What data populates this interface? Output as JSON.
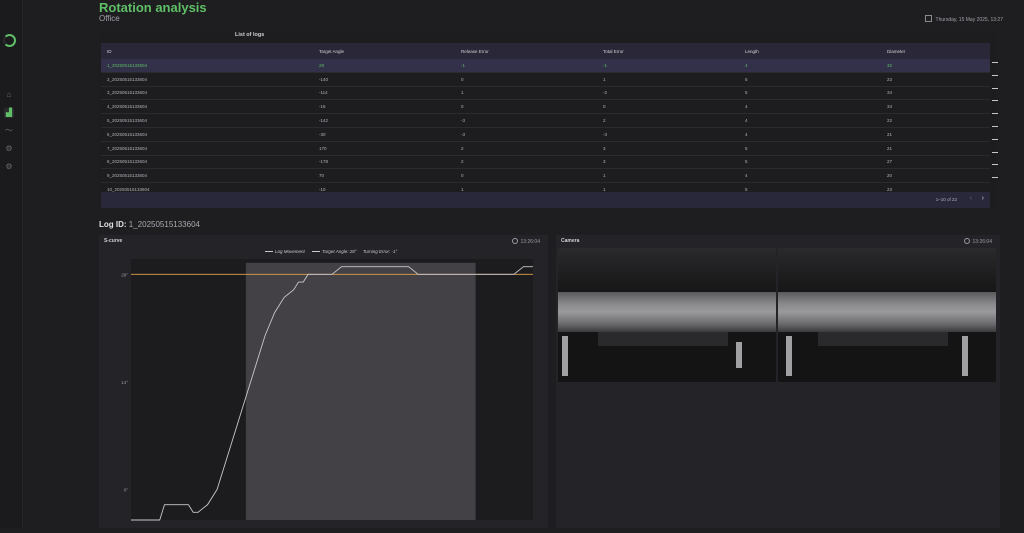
{
  "header": {
    "title": "Rotation analysis",
    "subtitle": "Office",
    "datetime": "Thursday, 15 May 2025, 13:27"
  },
  "table": {
    "title": "List of logs",
    "columns": [
      "ID",
      "Target Angle",
      "Release Error",
      "Total Error",
      "Length",
      "Diameter"
    ],
    "rows": [
      [
        "1_20250515133604",
        "28",
        "-1",
        "-1",
        "4",
        "32"
      ],
      [
        "2_20250515133604",
        "-140",
        "0",
        "1",
        "5",
        "23"
      ],
      [
        "3_20250515133604",
        "-114",
        "1",
        "-2",
        "5",
        "34"
      ],
      [
        "4_20250515133604",
        "-16",
        "0",
        "0",
        "4",
        "34"
      ],
      [
        "5_20250515133604",
        "-142",
        "-3",
        "2",
        "4",
        "22"
      ],
      [
        "6_20250515133604",
        "-30",
        "-3",
        "-3",
        "4",
        "21"
      ],
      [
        "7_20250515133604",
        "170",
        "2",
        "3",
        "5",
        "21"
      ],
      [
        "8_20250515133604",
        "-178",
        "2",
        "3",
        "5",
        "27"
      ],
      [
        "9_20250515133604",
        "70",
        "0",
        "1",
        "4",
        "20"
      ],
      [
        "10_20250515133604",
        "-10",
        "1",
        "1",
        "5",
        "23"
      ]
    ],
    "selected_row": 0,
    "pagination": "1–10 of 22",
    "prev_icon": "chevron-left-icon",
    "next_icon": "chevron-right-icon"
  },
  "log": {
    "label": "Log ID:",
    "value": "1_20250515133604"
  },
  "scurve": {
    "title": "S-curve",
    "time": "13:26:04",
    "legend": {
      "movement": "Log Movement",
      "target": "Target Angle: 28°",
      "error": "Turning Error: -1°"
    }
  },
  "camera": {
    "title": "Camera",
    "time": "13:26:04"
  },
  "chart_data": {
    "type": "line",
    "title": "S-curve",
    "ytick_labels": [
      "28°",
      "14°",
      "0°"
    ],
    "ylim": [
      -4,
      30
    ],
    "series": [
      {
        "name": "Log Movement",
        "x": [
          0,
          30,
          35,
          60,
          65,
          70,
          80,
          90,
          100,
          110,
          120,
          130,
          140,
          150,
          160,
          170,
          175,
          180,
          185,
          195,
          210,
          220,
          250,
          260,
          290,
          300,
          320,
          360,
          370,
          385,
          400,
          410,
          420
        ],
        "y": [
          -4,
          -4,
          -2,
          -2,
          -3,
          -3,
          -2,
          0,
          4,
          8,
          12,
          16,
          20,
          23,
          25,
          26,
          27,
          27,
          28,
          28,
          28,
          29,
          29,
          29,
          29,
          28,
          28,
          28,
          28,
          28,
          28,
          29,
          29
        ]
      },
      {
        "name": "Target Angle: 28°",
        "x": [
          0,
          420
        ],
        "y": [
          28,
          28
        ]
      }
    ],
    "highlight_x_range": [
      120,
      360
    ],
    "colors": {
      "movement": "#c8c8cc",
      "target": "#e0a050",
      "highlight": "#4a484e"
    }
  },
  "colors": {
    "accent": "#5fbf66",
    "background": "#1e1e21",
    "panel": "#242428",
    "selected_row": "#33304a"
  }
}
